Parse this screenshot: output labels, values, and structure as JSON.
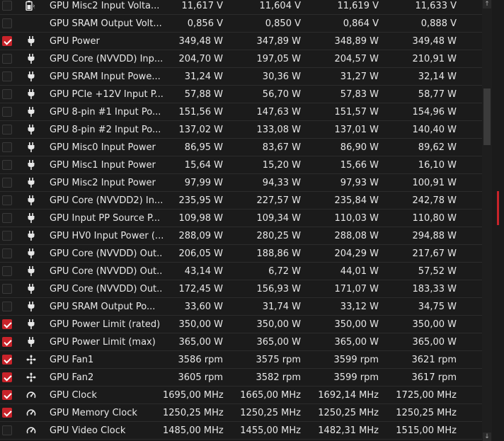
{
  "colors": {
    "accent": "#c8232a",
    "background": "#1b1b1b",
    "text": "#e8e8e8"
  },
  "scroll_up_glyph": "↑",
  "scroll_down_glyph": "↓",
  "rows": [
    {
      "name": "GPU Misc2 Input Volta...",
      "icon": "battery-icon",
      "checked": false,
      "v1": "11,617 V",
      "v2": "11,604 V",
      "v3": "11,619 V",
      "v4": "11,633 V"
    },
    {
      "name": "GPU SRAM Output Volt...",
      "icon": "none",
      "checked": false,
      "v1": "0,856 V",
      "v2": "0,850 V",
      "v3": "0,864 V",
      "v4": "0,888 V"
    },
    {
      "name": "GPU Power",
      "icon": "plug-icon",
      "checked": true,
      "v1": "349,48 W",
      "v2": "347,89 W",
      "v3": "348,89 W",
      "v4": "349,48 W"
    },
    {
      "name": "GPU Core (NVVDD) Inp...",
      "icon": "plug-icon",
      "checked": false,
      "v1": "204,70 W",
      "v2": "197,05 W",
      "v3": "204,57 W",
      "v4": "210,91 W"
    },
    {
      "name": "GPU SRAM Input Powe...",
      "icon": "plug-icon",
      "checked": false,
      "v1": "31,24 W",
      "v2": "30,36 W",
      "v3": "31,27 W",
      "v4": "32,14 W"
    },
    {
      "name": "GPU PCIe +12V Input P...",
      "icon": "plug-icon",
      "checked": false,
      "v1": "57,88 W",
      "v2": "56,70 W",
      "v3": "57,83 W",
      "v4": "58,77 W"
    },
    {
      "name": "GPU 8-pin #1 Input Po...",
      "icon": "plug-icon",
      "checked": false,
      "v1": "151,56 W",
      "v2": "147,63 W",
      "v3": "151,57 W",
      "v4": "154,96 W"
    },
    {
      "name": "GPU 8-pin #2 Input Po...",
      "icon": "plug-icon",
      "checked": false,
      "v1": "137,02 W",
      "v2": "133,08 W",
      "v3": "137,01 W",
      "v4": "140,40 W"
    },
    {
      "name": "GPU Misc0 Input Power",
      "icon": "plug-icon",
      "checked": false,
      "v1": "86,95 W",
      "v2": "83,67 W",
      "v3": "86,90 W",
      "v4": "89,62 W"
    },
    {
      "name": "GPU Misc1 Input Power",
      "icon": "plug-icon",
      "checked": false,
      "v1": "15,64 W",
      "v2": "15,20 W",
      "v3": "15,66 W",
      "v4": "16,10 W"
    },
    {
      "name": "GPU Misc2 Input Power",
      "icon": "plug-icon",
      "checked": false,
      "v1": "97,99 W",
      "v2": "94,33 W",
      "v3": "97,93 W",
      "v4": "100,91 W"
    },
    {
      "name": "GPU Core (NVVDD2) In...",
      "icon": "plug-icon",
      "checked": false,
      "v1": "235,95 W",
      "v2": "227,57 W",
      "v3": "235,84 W",
      "v4": "242,78 W"
    },
    {
      "name": "GPU Input PP Source P...",
      "icon": "plug-icon",
      "checked": false,
      "v1": "109,98 W",
      "v2": "109,34 W",
      "v3": "110,03 W",
      "v4": "110,80 W"
    },
    {
      "name": "GPU HV0 Input Power (...",
      "icon": "plug-icon",
      "checked": false,
      "v1": "288,09 W",
      "v2": "280,25 W",
      "v3": "288,08 W",
      "v4": "294,88 W"
    },
    {
      "name": "GPU Core (NVVDD) Out...",
      "icon": "plug-icon",
      "checked": false,
      "v1": "206,05 W",
      "v2": "188,86 W",
      "v3": "204,29 W",
      "v4": "217,67 W"
    },
    {
      "name": "GPU Core (NVVDD) Out...",
      "icon": "plug-icon",
      "checked": false,
      "v1": "43,14 W",
      "v2": "6,72 W",
      "v3": "44,01 W",
      "v4": "57,52 W"
    },
    {
      "name": "GPU Core (NVVDD) Out...",
      "icon": "plug-icon",
      "checked": false,
      "v1": "172,45 W",
      "v2": "156,93 W",
      "v3": "171,07 W",
      "v4": "183,33 W"
    },
    {
      "name": "GPU SRAM Output Po...",
      "icon": "plug-icon",
      "checked": false,
      "v1": "33,60 W",
      "v2": "31,74 W",
      "v3": "33,12 W",
      "v4": "34,75 W"
    },
    {
      "name": "GPU Power Limit (rated)",
      "icon": "plug-icon",
      "checked": true,
      "v1": "350,00 W",
      "v2": "350,00 W",
      "v3": "350,00 W",
      "v4": "350,00 W"
    },
    {
      "name": "GPU Power Limit (max)",
      "icon": "plug-icon",
      "checked": true,
      "v1": "365,00 W",
      "v2": "365,00 W",
      "v3": "365,00 W",
      "v4": "365,00 W"
    },
    {
      "name": "GPU Fan1",
      "icon": "fan-icon",
      "checked": true,
      "v1": "3586 rpm",
      "v2": "3575 rpm",
      "v3": "3599 rpm",
      "v4": "3621 rpm"
    },
    {
      "name": "GPU Fan2",
      "icon": "fan-icon",
      "checked": true,
      "v1": "3605 rpm",
      "v2": "3582 rpm",
      "v3": "3599 rpm",
      "v4": "3617 rpm"
    },
    {
      "name": "GPU Clock",
      "icon": "gauge-icon",
      "checked": true,
      "v1": "1695,00 MHz",
      "v2": "1665,00 MHz",
      "v3": "1692,14 MHz",
      "v4": "1725,00 MHz"
    },
    {
      "name": "GPU Memory Clock",
      "icon": "gauge-icon",
      "checked": true,
      "v1": "1250,25 MHz",
      "v2": "1250,25 MHz",
      "v3": "1250,25 MHz",
      "v4": "1250,25 MHz"
    },
    {
      "name": "GPU Video Clock",
      "icon": "gauge-icon",
      "checked": false,
      "v1": "1485,00 MHz",
      "v2": "1455,00 MHz",
      "v3": "1482,31 MHz",
      "v4": "1515,00 MHz"
    }
  ]
}
